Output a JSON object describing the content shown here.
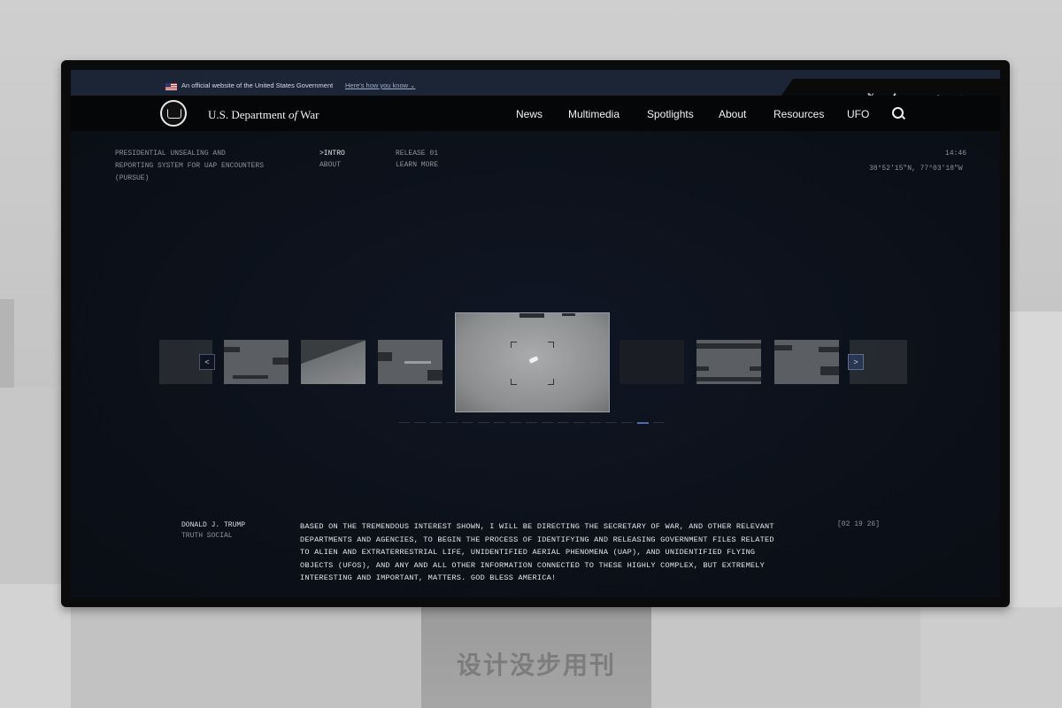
{
  "banner": {
    "official_text": "An official website of the United States Government",
    "how_link": "Here's how you know ⌄"
  },
  "social": [
    {
      "icon": "x-icon",
      "glyph": "𝕏"
    },
    {
      "icon": "facebook-icon",
      "glyph": "f"
    },
    {
      "icon": "instagram-icon",
      "glyph": "◎"
    },
    {
      "icon": "linkedin-icon",
      "glyph": "in"
    },
    {
      "icon": "youtube-icon",
      "glyph": "▶"
    }
  ],
  "header": {
    "brand_prefix": "U.S. Department ",
    "brand_of": "of",
    "brand_suffix": " War",
    "nav": [
      "News",
      "Multimedia",
      "Spotlights",
      "About",
      "Resources",
      "UFO"
    ]
  },
  "info": {
    "program": "PRESIDENTIAL UNSEALING AND\nREPORTING SYSTEM FOR UAP ENCOUNTERS\n(PURSUE)",
    "intro": ">INTRO",
    "about": "ABOUT",
    "release": "RELEASE 01",
    "learn_more": "LEARN MORE",
    "time": "14:46",
    "coords": "38°52'15\"N, 77°03'18\"W"
  },
  "carousel": {
    "prev_label": "<",
    "next_label": ">",
    "dot_count": 17,
    "active_dot": 15
  },
  "quote": {
    "author": "DONALD J. TRUMP",
    "source": "TRUTH SOCIAL",
    "text": "BASED ON THE TREMENDOUS INTEREST SHOWN, I WILL BE DIRECTING THE SECRETARY OF WAR, AND OTHER RELEVANT DEPARTMENTS AND AGENCIES, TO BEGIN THE PROCESS OF IDENTIFYING AND RELEASING GOVERNMENT FILES RELATED TO ALIEN AND EXTRATERRESTRIAL LIFE, UNIDENTIFIED AERIAL PHENOMENA (UAP), AND UNIDENTIFIED FLYING OBJECTS (UFOS), AND ANY AND ALL OTHER INFORMATION CONNECTED TO THESE HIGHLY COMPLEX, BUT EXTREMELY INTERESTING AND IMPORTANT, MATTERS. GOD BLESS AMERICA!",
    "date": "[02 19 26]"
  },
  "stand": {
    "logo_text": "设计没步用刊"
  }
}
